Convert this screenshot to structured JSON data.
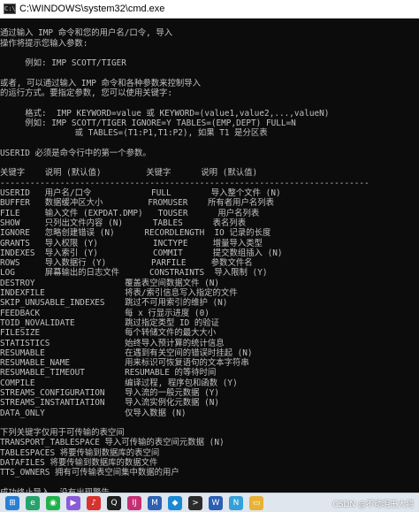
{
  "window": {
    "title": "C:\\WINDOWS\\system32\\cmd.exe",
    "icon": "cmd-icon"
  },
  "console_lines": [
    "",
    "通过输入 IMP 命令和您的用户名/口令, 导入",
    "操作将提示您输入参数:",
    "",
    "     例如: IMP SCOTT/TIGER",
    "",
    "或者, 可以通过输入 IMP 命令和各种参数来控制导入",
    "的运行方式。要指定参数, 您可以使用关键字:",
    "",
    "     格式:  IMP KEYWORD=value 或 KEYWORD=(value1,value2,...,valueN)",
    "     例如: IMP SCOTT/TIGER IGNORE=Y TABLES=(EMP,DEPT) FULL=N",
    "               或 TABLES=(T1:P1,T1:P2), 如果 T1 是分区表",
    "",
    "USERID 必须是命令行中的第一个参数。",
    "",
    "关键字    说明 (默认值)         关键字      说明 (默认值)",
    "--------------------------------------------------------------------------",
    "USERID   用户名/口令            FULL        导入整个文件 (N)",
    "BUFFER   数据缓冲区大小         FROMUSER    所有者用户名列表",
    "FILE     输入文件 (EXPDAT.DMP)   TOUSER      用户名列表",
    "SHOW     只列出文件内容 (N)      TABLES      表名列表",
    "IGNORE   忽略创建错误 (N)      RECORDLENGTH  IO 记录的长度",
    "GRANTS   导入权限 (Y)           INCTYPE     增量导入类型",
    "INDEXES  导入索引 (Y)           COMMIT      提交数组插入 (N)",
    "ROWS     导入数据行 (Y)         PARFILE     参数文件名",
    "LOG      屏幕输出的日志文件      CONSTRAINTS  导入限制 (Y)",
    "DESTROY                  覆盖表空间数据文件 (N)",
    "INDEXFILE                将表/索引信息写入指定的文件",
    "SKIP_UNUSABLE_INDEXES    跳过不可用索引的维护 (N)",
    "FEEDBACK                 每 x 行显示进度 (0)",
    "TOID_NOVALIDATE          跳过指定类型 ID 的验证",
    "FILESIZE                 每个转储文件的最大大小",
    "STATISTICS               始终导入预计算的统计信息",
    "RESUMABLE                在遇到有关空间的错误时挂起 (N)",
    "RESUMABLE_NAME           用来标识可恢复语句的文本字符串",
    "RESUMABLE_TIMEOUT        RESUMABLE 的等待时间",
    "COMPILE                  编译过程, 程序包和函数 (Y)",
    "STREAMS_CONFIGURATION    导入流的一般元数据 (Y)",
    "STREAMS_INSTANTIATION    导入流实例化元数据 (N)",
    "DATA_ONLY                仅导入数据 (N)",
    "",
    "下列关键字仅用于可传输的表空间",
    "TRANSPORT_TABLESPACE 导入可传输的表空间元数据 (N)",
    "TABLESPACES 将要传输到数据库的表空间",
    "DATAFILES 将要传输到数据库的数据文件",
    "TTS_OWNERS 拥有可传输表空间集中数据的用户",
    "",
    "成功终止导入, 没有出现警告。"
  ],
  "taskbar": {
    "icons": [
      {
        "name": "windows-start-icon",
        "color": "#2a7fd4",
        "glyph": "⊞"
      },
      {
        "name": "edge-browser-icon",
        "color": "#24a36b",
        "glyph": "e"
      },
      {
        "name": "wechat-icon",
        "color": "#21b14a",
        "glyph": "◉"
      },
      {
        "name": "visual-studio-icon",
        "color": "#8a5bd6",
        "glyph": "▶"
      },
      {
        "name": "netease-music-icon",
        "color": "#d7322e",
        "glyph": "♪"
      },
      {
        "name": "qq-icon",
        "color": "#1f1f1f",
        "glyph": "Q"
      },
      {
        "name": "intellij-icon",
        "color": "#c53075",
        "glyph": "IJ"
      },
      {
        "name": "maven-icon",
        "color": "#2c61b5",
        "glyph": "M"
      },
      {
        "name": "vscode-icon",
        "color": "#1a8ad4",
        "glyph": "◆"
      },
      {
        "name": "terminal-icon",
        "color": "#2b2b2b",
        "glyph": ">"
      },
      {
        "name": "word-icon",
        "color": "#2b5fb3",
        "glyph": "W"
      },
      {
        "name": "navicat-icon",
        "color": "#35a0d8",
        "glyph": "N"
      },
      {
        "name": "file-explorer-icon",
        "color": "#e8b236",
        "glyph": "▭"
      }
    ],
    "watermark": "CSDN @不动明王大将"
  }
}
